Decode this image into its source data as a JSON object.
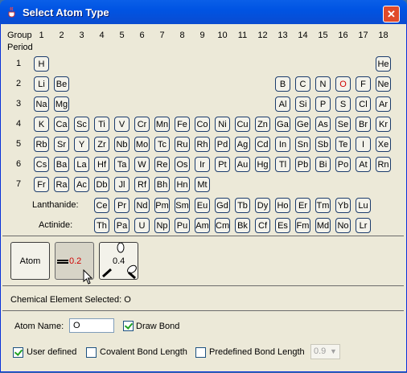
{
  "window": {
    "title": "Select Atom Type",
    "close": "✕"
  },
  "header": {
    "group_label": "Group",
    "period_label": "Period",
    "groups": [
      "1",
      "2",
      "3",
      "4",
      "5",
      "6",
      "7",
      "8",
      "9",
      "10",
      "11",
      "12",
      "13",
      "14",
      "15",
      "16",
      "17",
      "18"
    ],
    "periods": [
      "1",
      "2",
      "3",
      "4",
      "5",
      "6",
      "7"
    ],
    "lanthanide_label": "Lanthanide:",
    "actinide_label": "Actinide:"
  },
  "elements": [
    {
      "s": "H",
      "r": 1,
      "c": 1
    },
    {
      "s": "He",
      "r": 1,
      "c": 18
    },
    {
      "s": "Li",
      "r": 2,
      "c": 1
    },
    {
      "s": "Be",
      "r": 2,
      "c": 2
    },
    {
      "s": "B",
      "r": 2,
      "c": 13
    },
    {
      "s": "C",
      "r": 2,
      "c": 14
    },
    {
      "s": "N",
      "r": 2,
      "c": 15
    },
    {
      "s": "O",
      "r": 2,
      "c": 16,
      "red": true
    },
    {
      "s": "F",
      "r": 2,
      "c": 17
    },
    {
      "s": "Ne",
      "r": 2,
      "c": 18
    },
    {
      "s": "Na",
      "r": 3,
      "c": 1
    },
    {
      "s": "Mg",
      "r": 3,
      "c": 2
    },
    {
      "s": "Al",
      "r": 3,
      "c": 13
    },
    {
      "s": "Si",
      "r": 3,
      "c": 14
    },
    {
      "s": "P",
      "r": 3,
      "c": 15
    },
    {
      "s": "S",
      "r": 3,
      "c": 16
    },
    {
      "s": "Cl",
      "r": 3,
      "c": 17
    },
    {
      "s": "Ar",
      "r": 3,
      "c": 18
    },
    {
      "s": "K",
      "r": 4,
      "c": 1
    },
    {
      "s": "Ca",
      "r": 4,
      "c": 2
    },
    {
      "s": "Sc",
      "r": 4,
      "c": 3
    },
    {
      "s": "Ti",
      "r": 4,
      "c": 4
    },
    {
      "s": "V",
      "r": 4,
      "c": 5
    },
    {
      "s": "Cr",
      "r": 4,
      "c": 6
    },
    {
      "s": "Mn",
      "r": 4,
      "c": 7
    },
    {
      "s": "Fe",
      "r": 4,
      "c": 8
    },
    {
      "s": "Co",
      "r": 4,
      "c": 9
    },
    {
      "s": "Ni",
      "r": 4,
      "c": 10
    },
    {
      "s": "Cu",
      "r": 4,
      "c": 11
    },
    {
      "s": "Zn",
      "r": 4,
      "c": 12
    },
    {
      "s": "Ga",
      "r": 4,
      "c": 13
    },
    {
      "s": "Ge",
      "r": 4,
      "c": 14
    },
    {
      "s": "As",
      "r": 4,
      "c": 15
    },
    {
      "s": "Se",
      "r": 4,
      "c": 16
    },
    {
      "s": "Br",
      "r": 4,
      "c": 17
    },
    {
      "s": "Kr",
      "r": 4,
      "c": 18
    },
    {
      "s": "Rb",
      "r": 5,
      "c": 1
    },
    {
      "s": "Sr",
      "r": 5,
      "c": 2
    },
    {
      "s": "Y",
      "r": 5,
      "c": 3
    },
    {
      "s": "Zr",
      "r": 5,
      "c": 4
    },
    {
      "s": "Nb",
      "r": 5,
      "c": 5
    },
    {
      "s": "Mo",
      "r": 5,
      "c": 6
    },
    {
      "s": "Tc",
      "r": 5,
      "c": 7
    },
    {
      "s": "Ru",
      "r": 5,
      "c": 8
    },
    {
      "s": "Rh",
      "r": 5,
      "c": 9
    },
    {
      "s": "Pd",
      "r": 5,
      "c": 10
    },
    {
      "s": "Ag",
      "r": 5,
      "c": 11
    },
    {
      "s": "Cd",
      "r": 5,
      "c": 12
    },
    {
      "s": "In",
      "r": 5,
      "c": 13
    },
    {
      "s": "Sn",
      "r": 5,
      "c": 14
    },
    {
      "s": "Sb",
      "r": 5,
      "c": 15
    },
    {
      "s": "Te",
      "r": 5,
      "c": 16
    },
    {
      "s": "I",
      "r": 5,
      "c": 17
    },
    {
      "s": "Xe",
      "r": 5,
      "c": 18
    },
    {
      "s": "Cs",
      "r": 6,
      "c": 1
    },
    {
      "s": "Ba",
      "r": 6,
      "c": 2
    },
    {
      "s": "La",
      "r": 6,
      "c": 3
    },
    {
      "s": "Hf",
      "r": 6,
      "c": 4
    },
    {
      "s": "Ta",
      "r": 6,
      "c": 5
    },
    {
      "s": "W",
      "r": 6,
      "c": 6
    },
    {
      "s": "Re",
      "r": 6,
      "c": 7
    },
    {
      "s": "Os",
      "r": 6,
      "c": 8
    },
    {
      "s": "Ir",
      "r": 6,
      "c": 9
    },
    {
      "s": "Pt",
      "r": 6,
      "c": 10
    },
    {
      "s": "Au",
      "r": 6,
      "c": 11
    },
    {
      "s": "Hg",
      "r": 6,
      "c": 12
    },
    {
      "s": "Tl",
      "r": 6,
      "c": 13
    },
    {
      "s": "Pb",
      "r": 6,
      "c": 14
    },
    {
      "s": "Bi",
      "r": 6,
      "c": 15
    },
    {
      "s": "Po",
      "r": 6,
      "c": 16
    },
    {
      "s": "At",
      "r": 6,
      "c": 17
    },
    {
      "s": "Rn",
      "r": 6,
      "c": 18
    },
    {
      "s": "Fr",
      "r": 7,
      "c": 1
    },
    {
      "s": "Ra",
      "r": 7,
      "c": 2
    },
    {
      "s": "Ac",
      "r": 7,
      "c": 3
    },
    {
      "s": "Db",
      "r": 7,
      "c": 4
    },
    {
      "s": "Jl",
      "r": 7,
      "c": 5
    },
    {
      "s": "Rf",
      "r": 7,
      "c": 6
    },
    {
      "s": "Bh",
      "r": 7,
      "c": 7
    },
    {
      "s": "Hn",
      "r": 7,
      "c": 8
    },
    {
      "s": "Mt",
      "r": 7,
      "c": 9
    }
  ],
  "lanthanides": [
    "Ce",
    "Pr",
    "Nd",
    "Pm",
    "Sm",
    "Eu",
    "Gd",
    "Tb",
    "Dy",
    "Ho",
    "Er",
    "Tm",
    "Yb",
    "Lu"
  ],
  "actinides": [
    "Th",
    "Pa",
    "U",
    "Np",
    "Pu",
    "Am",
    "Cm",
    "Bk",
    "Cf",
    "Es",
    "Fm",
    "Md",
    "No",
    "Lr"
  ],
  "buttons": {
    "atom": "Atom",
    "double_bond_value": "0.2",
    "angle_value": "0.4"
  },
  "status": {
    "selected": "Chemical Element Selected: O"
  },
  "form": {
    "atom_name_label": "Atom Name:",
    "atom_name_value": "O",
    "draw_bond_label": "Draw Bond",
    "draw_bond_checked": true,
    "user_defined_label": "User defined",
    "user_defined_checked": true,
    "covalent_label": "Covalent Bond Length",
    "covalent_checked": false,
    "predefined_label": "Predefined Bond Length",
    "predefined_checked": false,
    "predefined_value": "0.9"
  },
  "colors": {
    "title_bar": "#0054e3",
    "selected_text": "#d00000",
    "panel": "#ece9d8"
  },
  "icons": {
    "app": "java-cup-icon",
    "close": "close-icon",
    "cursor": "mouse-pointer-icon"
  }
}
